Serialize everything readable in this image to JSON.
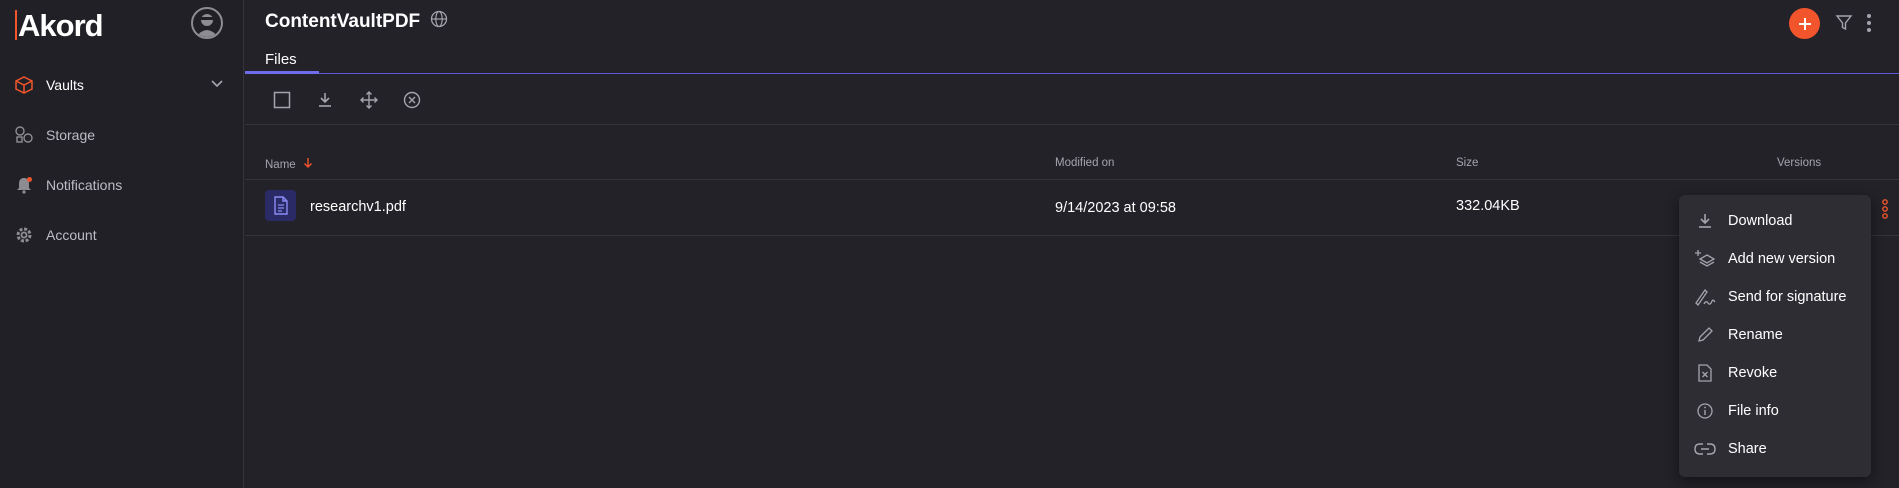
{
  "sidebar": {
    "logo_text": "Akord",
    "items": [
      {
        "label": "Vaults",
        "icon": "vault-icon",
        "active": true
      },
      {
        "label": "Storage",
        "icon": "storage-icon"
      },
      {
        "label": "Notifications",
        "icon": "bell-icon"
      },
      {
        "label": "Account",
        "icon": "gear-icon"
      }
    ]
  },
  "header": {
    "title": "ContentVaultPDF",
    "tab": "Files"
  },
  "table": {
    "columns": {
      "name": "Name",
      "modified": "Modified on",
      "size": "Size",
      "versions": "Versions"
    },
    "rows": [
      {
        "name": "researchv1.pdf",
        "modified": "9/14/2023 at 09:58",
        "size": "332.04KB"
      }
    ]
  },
  "context_menu": {
    "items": [
      {
        "label": "Download",
        "icon": "download-icon"
      },
      {
        "label": "Add new version",
        "icon": "add-version-icon"
      },
      {
        "label": "Send for signature",
        "icon": "signature-icon"
      },
      {
        "label": "Rename",
        "icon": "pencil-icon"
      },
      {
        "label": "Revoke",
        "icon": "revoke-icon"
      },
      {
        "label": "File info",
        "icon": "info-icon"
      },
      {
        "label": "Share",
        "icon": "link-icon"
      }
    ]
  },
  "colors": {
    "accent": "#f2552c",
    "tab_accent": "#6f6cf0",
    "background": "#232228",
    "pdf_icon_bg": "#2a2b66"
  }
}
